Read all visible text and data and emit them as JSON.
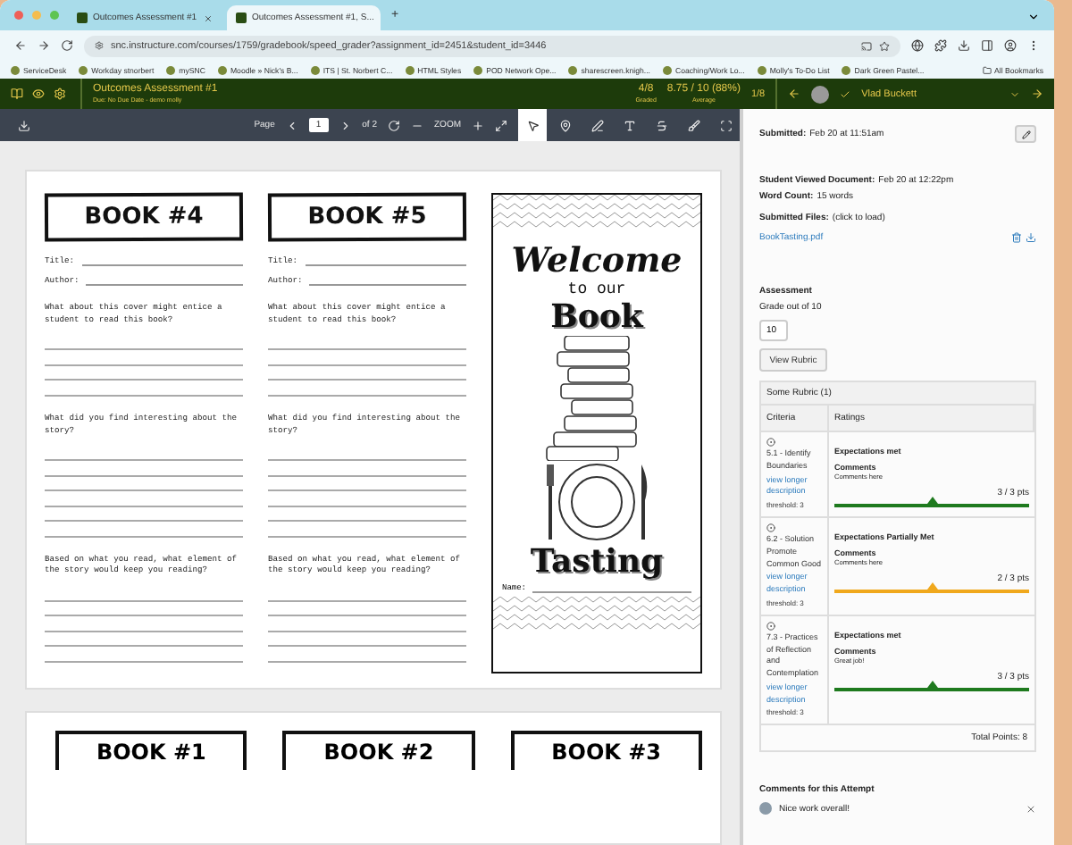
{
  "browser": {
    "tabs": [
      {
        "title": "Outcomes Assessment #1",
        "selected": false
      },
      {
        "title": "Outcomes Assessment #1, S...",
        "selected": true
      }
    ],
    "new_tab": "+",
    "url": "snc.instructure.com/courses/1759/gradebook/speed_grader?assignment_id=2451&student_id=3446",
    "bookmarks": [
      "ServiceDesk",
      "Workday stnorbert",
      "mySNC",
      "Moodle » Nick's B...",
      "ITS | St. Norbert C...",
      "HTML Styles",
      "POD Network Ope...",
      "sharescreen.knigh...",
      "Coaching/Work Lo...",
      "Molly's To-Do List",
      "Dark Green Pastel..."
    ],
    "all_bookmarks": "All Bookmarks"
  },
  "header": {
    "title": "Outcomes Assessment #1",
    "due": "Due: No Due Date - demo molly",
    "stats": [
      {
        "value": "4/8",
        "label": "Graded"
      },
      {
        "value": "8.75 / 10 (88%)",
        "label": "Average"
      }
    ],
    "position": "1/8",
    "student": "Vlad Buckett"
  },
  "toolbar": {
    "page_label": "Page",
    "page": "1",
    "page_count": "of 2",
    "zoom": "ZOOM",
    "tools": [
      {
        "kind": "pointer",
        "selected": true
      },
      {
        "kind": "pin",
        "selected": false
      },
      {
        "kind": "pen",
        "selected": false
      },
      {
        "kind": "text",
        "selected": false
      },
      {
        "kind": "strike",
        "selected": false
      },
      {
        "kind": "brush",
        "selected": false
      },
      {
        "kind": "frame",
        "selected": false
      }
    ]
  },
  "document": {
    "columns": [
      {
        "heading": "BOOK #4",
        "fields": [
          "Title:",
          "Author:"
        ],
        "questions": [
          "What about this cover might entice a student to read this book?",
          "What did you find interesting about the story?",
          "Based on what you read, what element of the story would keep you reading?"
        ]
      },
      {
        "heading": "BOOK #5",
        "fields": [
          "Title:",
          "Author:"
        ],
        "questions": [
          "What about this cover might entice a student to read this book?",
          "What did you find interesting about the story?",
          "Based on what you read, what element of the story would keep you reading?"
        ]
      }
    ],
    "poster": {
      "welcome": "Welcome",
      "to_our": "to our",
      "book": "Book",
      "tasting": "Tasting",
      "name_label": "Name:"
    },
    "next_page_headings": [
      "BOOK #1",
      "BOOK #2",
      "BOOK #3"
    ]
  },
  "panel": {
    "submitted_label": "Submitted:",
    "submitted": "Feb 20 at 11:51am",
    "details": [
      {
        "label": "Student Viewed Document:",
        "value": "Feb 20 at 12:22pm"
      },
      {
        "label": "Word Count:",
        "value": "15 words"
      }
    ],
    "files_label": "Submitted Files:",
    "files_hint": "(click to load)",
    "file": "BookTasting.pdf",
    "assessment": "Assessment",
    "grade_hint": "Grade out of 10",
    "grade": "10",
    "view_rubric": "View Rubric",
    "rubric": {
      "title": "Some Rubric (1)",
      "columns": [
        "Criteria",
        "Ratings"
      ],
      "rows": [
        {
          "criterion": "5.1 - Identify Boundaries",
          "link": "view longer description",
          "threshold": "threshold: 3",
          "rating": "Expectations met",
          "comments_label": "Comments",
          "comment": "Comments here",
          "points": "3 / 3 pts",
          "color": "#1e7a1e"
        },
        {
          "criterion": "6.2 - Solution Promote Common Good",
          "link": "view longer description",
          "threshold": "threshold: 3",
          "rating": "Expectations Partially Met",
          "comments_label": "Comments",
          "comment": "Comments here",
          "points": "2 / 3 pts",
          "color": "#f0a81c"
        },
        {
          "criterion": "7.3 - Practices of Reflection and Contemplation",
          "link": "view longer description",
          "threshold": "threshold: 3",
          "rating": "Expectations met",
          "comments_label": "Comments",
          "comment": "Great job!",
          "points": "3 / 3 pts",
          "color": "#1e7a1e"
        }
      ],
      "total": "Total Points: 8"
    },
    "comments_title": "Comments for this Attempt",
    "comment": "Nice work overall!"
  }
}
